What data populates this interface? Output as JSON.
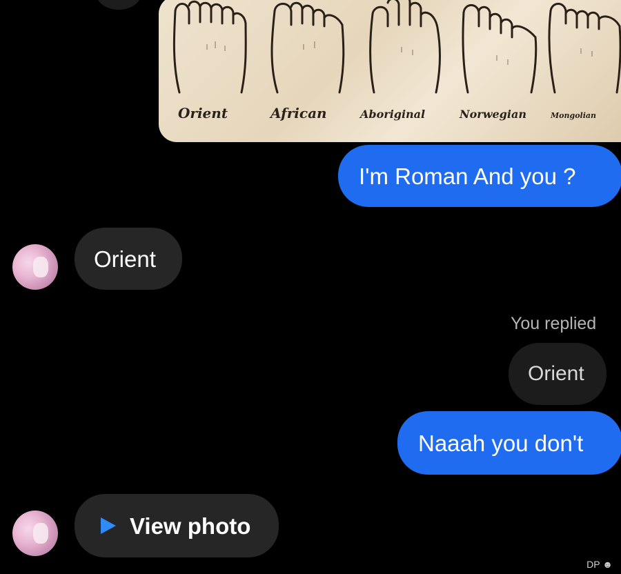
{
  "image_card": {
    "labels": [
      "Orient",
      "African",
      "Aboriginal",
      "Norwegian",
      "Mongolian"
    ]
  },
  "messages": {
    "outgoing_1": "I'm Roman And you ?",
    "incoming_1": "Orient",
    "reply_label": "You replied",
    "reply_quote": "Orient",
    "outgoing_2": "Naaah you don't",
    "incoming_2": "View photo"
  },
  "icons": {
    "view_photo": "play-triangle-icon"
  },
  "colors": {
    "outgoing_bubble": "#1f6cf0",
    "incoming_bubble": "#262626",
    "background": "#000000",
    "play_icon": "#2f8cf6"
  },
  "watermark": "DP"
}
